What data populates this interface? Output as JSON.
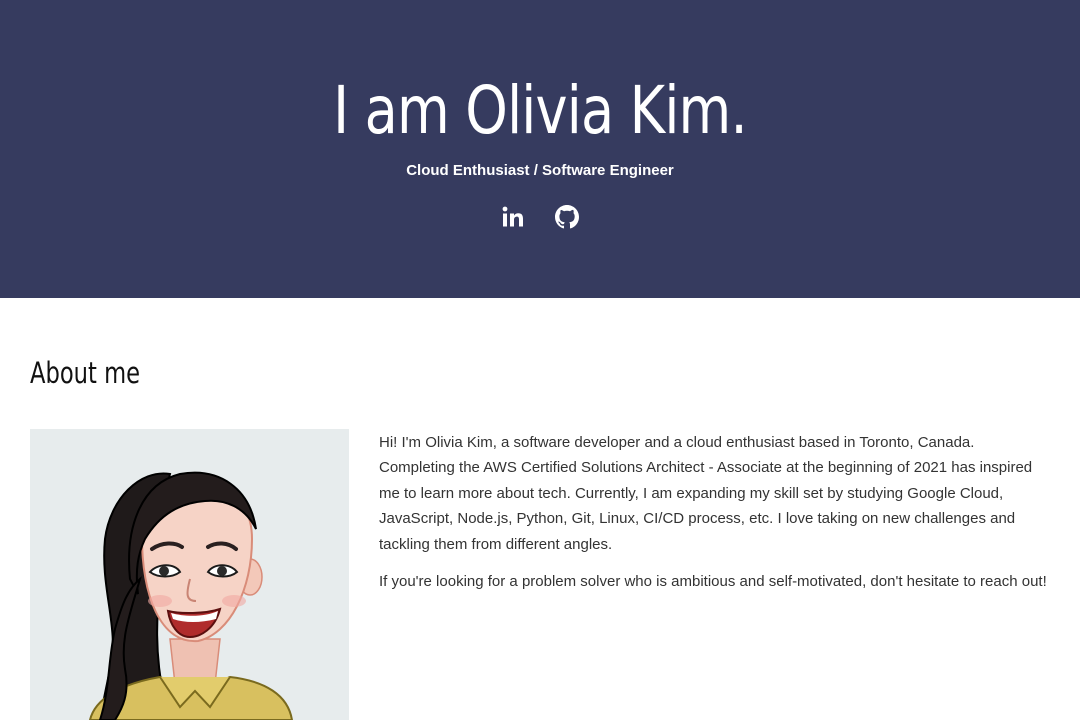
{
  "hero": {
    "title": "I am Olivia Kim.",
    "subtitle": "Cloud Enthusiast / Software Engineer",
    "background_color": "#363b5f",
    "social": [
      {
        "icon": "linkedin-icon",
        "label": "LinkedIn"
      },
      {
        "icon": "github-icon",
        "label": "GitHub"
      }
    ]
  },
  "about": {
    "heading": "About me",
    "paragraphs": [
      "Hi! I'm Olivia Kim, a software developer and a cloud enthusiast based in Toronto, Canada. Completing the AWS Certified Solutions Architect - Associate at the beginning of 2021 has inspired me to learn more about tech. Currently, I am expanding my skill set by studying Google Cloud, JavaScript, Node.js, Python, Git, Linux, CI/CD process, etc. I love taking on new challenges and tackling them from different angles.",
      "If you're looking for a problem solver who is ambitious and self-motivated, don't hesitate to reach out!"
    ],
    "portrait_background": "#e7eced"
  }
}
